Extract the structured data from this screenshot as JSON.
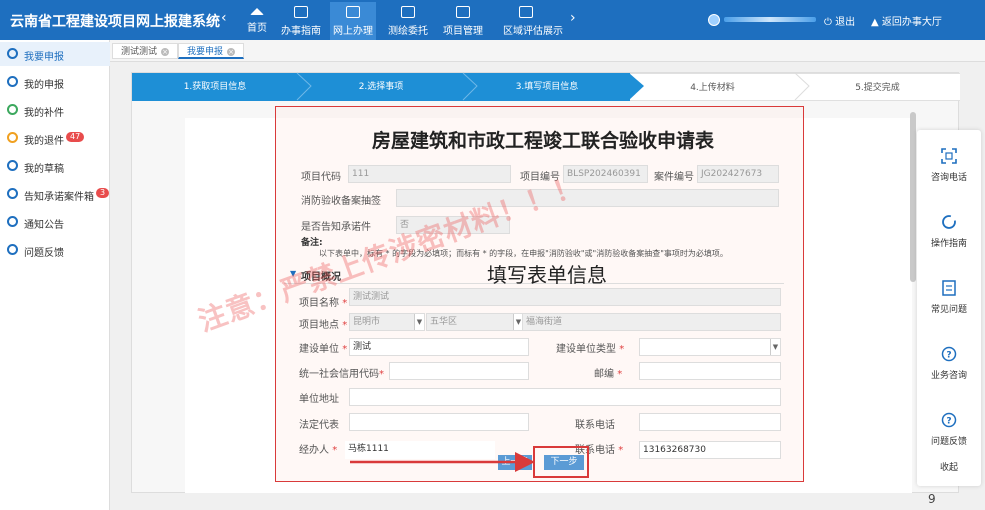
{
  "header": {
    "title": "云南省工程建设项目网上报建系统",
    "nav": [
      {
        "label": "首页",
        "icon": "home-icon"
      },
      {
        "label": "办事指南",
        "icon": "guide-icon"
      },
      {
        "label": "网上办理",
        "icon": "online-icon"
      },
      {
        "label": "测绘委托",
        "icon": "survey-icon"
      },
      {
        "label": "项目管理",
        "icon": "project-icon"
      },
      {
        "label": "区域评估展示",
        "icon": "region-icon"
      }
    ],
    "logout_label": "退出",
    "back_label": "返回办事大厅"
  },
  "sidebar": {
    "items": [
      {
        "label": "我要申报",
        "badge": ""
      },
      {
        "label": "我的申报",
        "badge": ""
      },
      {
        "label": "我的补件",
        "badge": ""
      },
      {
        "label": "我的退件",
        "badge": "47"
      },
      {
        "label": "我的草稿",
        "badge": ""
      },
      {
        "label": "告知承诺案件箱",
        "badge": "3"
      },
      {
        "label": "通知公告",
        "badge": ""
      },
      {
        "label": "问题反馈",
        "badge": ""
      }
    ]
  },
  "tabs": [
    {
      "label": "测试测试"
    },
    {
      "label": "我要申报"
    }
  ],
  "steps": [
    {
      "label": "1.获取项目信息"
    },
    {
      "label": "2.选择事项"
    },
    {
      "label": "3.填写项目信息"
    },
    {
      "label": "4.上传材料"
    },
    {
      "label": "5.提交完成"
    }
  ],
  "form": {
    "title": "房屋建筑和市政工程竣工联合验收申请表",
    "project_code_label": "项目代码",
    "project_code_value": "111",
    "project_no_label": "项目编号",
    "project_no_value": "BLSP202460391",
    "case_no_label": "案件编号",
    "case_no_value": "JG202427673",
    "fire_check_label": "消防验收备案抽签",
    "notify_label": "是否告知承诺件",
    "notify_value": "否",
    "remark_title": "备注:",
    "remark_text": "以下表单中，标有 * 的字段为必填项；而标有 * 的字段，在申报\"消防验收\"或\"消防验收备案抽查\"事项时为必填项。",
    "section_title": "项目概况",
    "project_name_label": "项目名称",
    "project_name_value": "测试测试",
    "location_label": "项目地点",
    "location_city": "昆明市",
    "location_district": "五华区",
    "location_street": "福海街道",
    "builder_label": "建设单位",
    "builder_value": "测试",
    "builder_type_label": "建设单位类型",
    "credit_code_label": "统一社会信用代码",
    "postcode_label": "邮编",
    "address_label": "单位地址",
    "legal_rep_label": "法定代表",
    "contact_phone_label": "联系电话",
    "operator_label": "经办人",
    "operator_value": "马栋1111",
    "operator_phone_label": "联系电话",
    "operator_phone_value": "13163268730"
  },
  "buttons": {
    "prev": "上一步",
    "next": "下一步"
  },
  "overlay": {
    "caption": "填写表单信息",
    "watermark": "注意：严禁上传涉密材料！！！"
  },
  "right_panel": {
    "items": [
      {
        "label": "咨询电话",
        "icon": "scan-icon"
      },
      {
        "label": "操作指南",
        "icon": "refresh-icon"
      },
      {
        "label": "常见问题",
        "icon": "document-icon"
      },
      {
        "label": "业务咨询",
        "icon": "help-icon"
      },
      {
        "label": "问题反馈",
        "icon": "help-icon"
      }
    ],
    "collapse_label": "收起"
  },
  "page_number": "9",
  "colors": {
    "header": "#1e6fbf",
    "step_done": "#1e8fd6",
    "highlight": "#d93a3a",
    "button": "#5b9bd5"
  }
}
